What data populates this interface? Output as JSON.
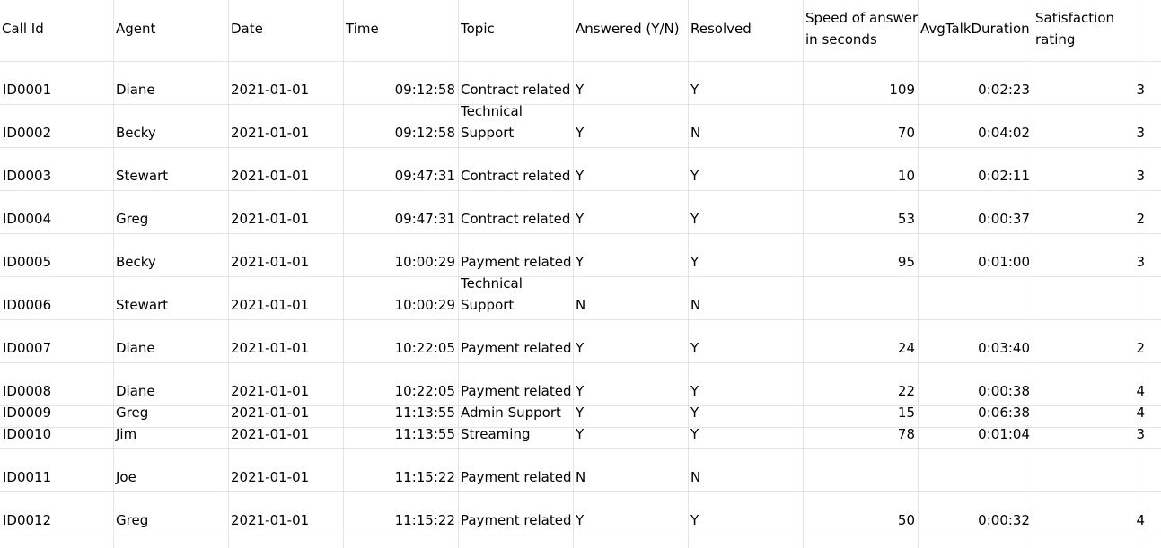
{
  "sheet": {
    "headers": [
      {
        "lines": [
          "Call Id"
        ]
      },
      {
        "lines": [
          "Agent"
        ]
      },
      {
        "lines": [
          "Date"
        ]
      },
      {
        "lines": [
          "Time"
        ]
      },
      {
        "lines": [
          "Topic"
        ]
      },
      {
        "lines": [
          "Answered (Y/N)"
        ]
      },
      {
        "lines": [
          "Resolved"
        ]
      },
      {
        "lines": [
          "Speed of answer",
          "in seconds"
        ]
      },
      {
        "lines": [
          "AvgTalkDuration"
        ]
      },
      {
        "lines": [
          "Satisfaction",
          "rating"
        ]
      }
    ],
    "rows": [
      [
        "ID0001",
        "Diane",
        "2021-01-01",
        "09:12:58",
        "Contract related",
        "Y",
        "Y",
        "109",
        "0:02:23",
        "3"
      ],
      [
        "ID0002",
        "Becky",
        "2021-01-01",
        "09:12:58",
        "Technical Support",
        "Y",
        "N",
        "70",
        "0:04:02",
        "3"
      ],
      [
        "ID0003",
        "Stewart",
        "2021-01-01",
        "09:47:31",
        "Contract related",
        "Y",
        "Y",
        "10",
        "0:02:11",
        "3"
      ],
      [
        "ID0004",
        "Greg",
        "2021-01-01",
        "09:47:31",
        "Contract related",
        "Y",
        "Y",
        "53",
        "0:00:37",
        "2"
      ],
      [
        "ID0005",
        "Becky",
        "2021-01-01",
        "10:00:29",
        "Payment related",
        "Y",
        "Y",
        "95",
        "0:01:00",
        "3"
      ],
      [
        "ID0006",
        "Stewart",
        "2021-01-01",
        "10:00:29",
        "Technical Support",
        "N",
        "N",
        "",
        "",
        ""
      ],
      [
        "ID0007",
        "Diane",
        "2021-01-01",
        "10:22:05",
        "Payment related",
        "Y",
        "Y",
        "24",
        "0:03:40",
        "2"
      ],
      [
        "ID0008",
        "Diane",
        "2021-01-01",
        "10:22:05",
        "Payment related",
        "Y",
        "Y",
        "22",
        "0:00:38",
        "4"
      ],
      [
        "ID0009",
        "Greg",
        "2021-01-01",
        "11:13:55",
        "Admin Support",
        "Y",
        "Y",
        "15",
        "0:06:38",
        "4"
      ],
      [
        "ID0010",
        "Jim",
        "2021-01-01",
        "11:13:55",
        "Streaming",
        "Y",
        "Y",
        "78",
        "0:01:04",
        "3"
      ],
      [
        "ID0011",
        "Joe",
        "2021-01-01",
        "11:15:22",
        "Payment related",
        "N",
        "N",
        "",
        "",
        ""
      ],
      [
        "ID0012",
        "Greg",
        "2021-01-01",
        "11:15:22",
        "Payment related",
        "Y",
        "Y",
        "50",
        "0:00:32",
        "4"
      ]
    ]
  }
}
